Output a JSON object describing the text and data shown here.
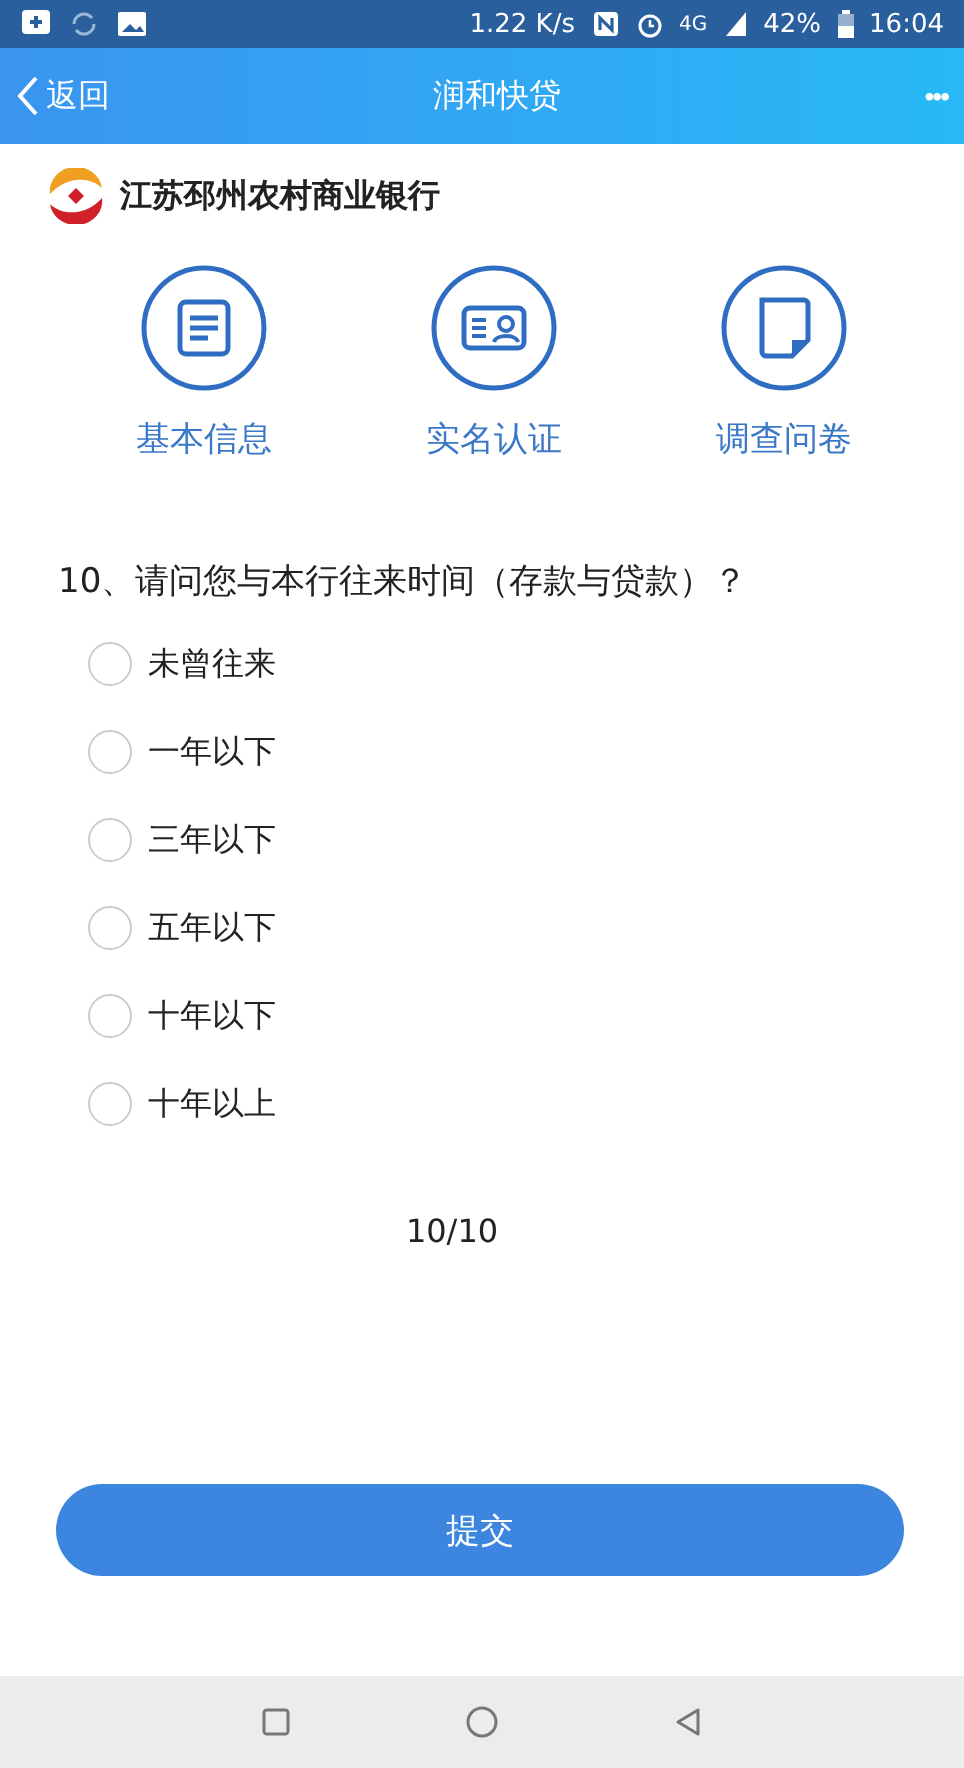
{
  "status_bar": {
    "speed": "1.22 K/s",
    "network": "4G",
    "battery": "42%",
    "time": "16:04"
  },
  "header": {
    "back": "返回",
    "title": "润和快贷",
    "more": "•••"
  },
  "bank": {
    "name": "江苏邳州农村商业银行"
  },
  "steps": [
    {
      "kind": "info",
      "label": "基本信息"
    },
    {
      "kind": "id",
      "label": "实名认证"
    },
    {
      "kind": "survey",
      "label": "调查问卷"
    }
  ],
  "question": {
    "text": "10、请问您与本行往来时间（存款与贷款）？",
    "options": [
      {
        "label": "未曾往来",
        "selected": false
      },
      {
        "label": "一年以下",
        "selected": false
      },
      {
        "label": "三年以下",
        "selected": false
      },
      {
        "label": "五年以下",
        "selected": false
      },
      {
        "label": "十年以下",
        "selected": false
      },
      {
        "label": "十年以上",
        "selected": false
      }
    ]
  },
  "pager": "10/10",
  "submit": "提交"
}
